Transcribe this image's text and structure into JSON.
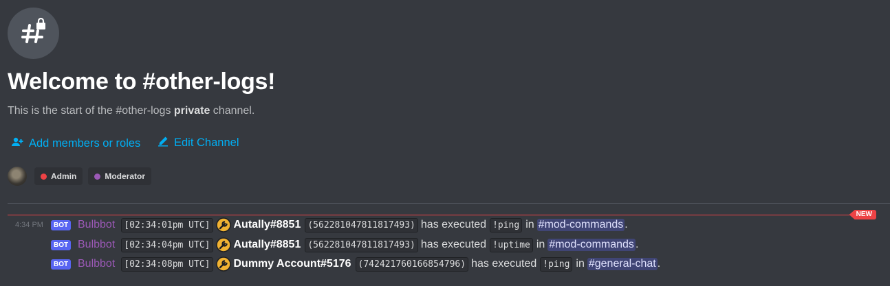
{
  "channel": {
    "icon": "hashtag-lock-icon",
    "title": "Welcome to #other-logs!",
    "subtitle_prefix": "This is the start of the #other-logs ",
    "subtitle_bold": "private",
    "subtitle_suffix": " channel."
  },
  "actions": {
    "add_members_label": "Add members or roles",
    "add_members_icon": "add-member-icon",
    "edit_channel_label": "Edit Channel",
    "edit_channel_icon": "pencil-icon"
  },
  "roles": [
    {
      "name": "Admin",
      "color": "#ed4245"
    },
    {
      "name": "Moderator",
      "color": "#9b59b6"
    }
  ],
  "new_badge": "NEW",
  "messages": [
    {
      "timestamp": "4:34 PM",
      "bot_tag": "BOT",
      "author": "Bulbbot",
      "time_code": "[02:34:01pm UTC]",
      "user": "Autally#8851",
      "user_id": "(562281047811817493)",
      "action_text": "has executed",
      "command": "!ping",
      "in_text": "in",
      "channel": "#mod-commands",
      "end": "."
    },
    {
      "timestamp": "",
      "bot_tag": "BOT",
      "author": "Bulbbot",
      "time_code": "[02:34:04pm UTC]",
      "user": "Autally#8851",
      "user_id": "(562281047811817493)",
      "action_text": "has executed",
      "command": "!uptime",
      "in_text": "in",
      "channel": "#mod-commands",
      "end": "."
    },
    {
      "timestamp": "",
      "bot_tag": "BOT",
      "author": "Bulbbot",
      "time_code": "[02:34:08pm UTC]",
      "user": "Dummy Account#5176",
      "user_id": "(742421760166854796)",
      "action_text": "has executed",
      "command": "!ping",
      "in_text": "in",
      "channel": "#general-chat",
      "end": "."
    }
  ],
  "colors": {
    "background": "#36393f",
    "link": "#00aff4",
    "bot_author": "#9b59b6",
    "new_marker": "#ed4245",
    "bot_tag": "#5865f2"
  }
}
